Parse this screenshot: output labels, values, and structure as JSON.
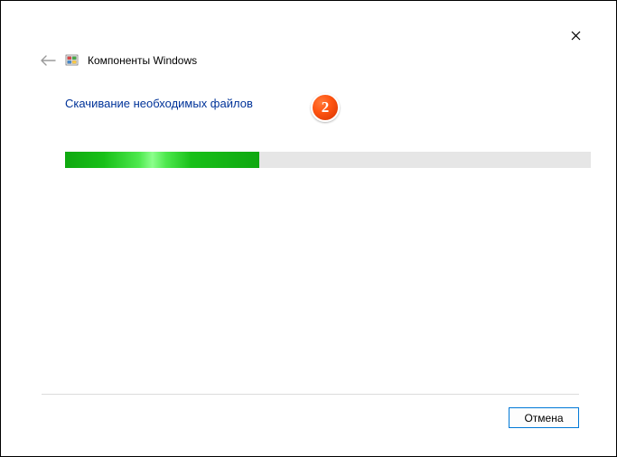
{
  "header": {
    "title": "Компоненты Windows"
  },
  "content": {
    "status": "Скачивание необходимых файлов",
    "progress_percent": 37
  },
  "badge": {
    "label": "2"
  },
  "footer": {
    "cancel_label": "Отмена"
  }
}
